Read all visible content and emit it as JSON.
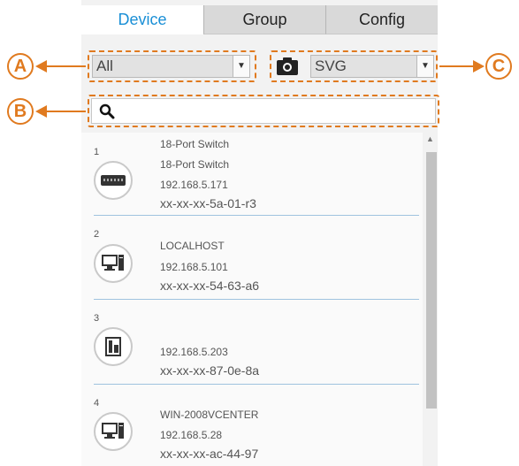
{
  "tabs": [
    {
      "label": "Device"
    },
    {
      "label": "Group"
    },
    {
      "label": "Config"
    }
  ],
  "filter": {
    "selected": "All"
  },
  "format": {
    "selected": "SVG"
  },
  "search": {
    "value": ""
  },
  "callouts": {
    "a": "A",
    "b": "B",
    "c": "C"
  },
  "devices": [
    {
      "index": "1",
      "name1": "18-Port Switch",
      "name2": "18-Port Switch",
      "ip": "192.168.5.171",
      "mac": "xx-xx-xx-5a-01-r3",
      "icon": "switch-icon"
    },
    {
      "index": "2",
      "name1": "LOCALHOST",
      "ip": "192.168.5.101",
      "mac": "xx-xx-xx-54-63-a6",
      "icon": "computer-icon"
    },
    {
      "index": "3",
      "name1": "",
      "ip": "192.168.5.203",
      "mac": "xx-xx-xx-87-0e-8a",
      "icon": "server-icon"
    },
    {
      "index": "4",
      "name1": "WIN-2008VCENTER",
      "ip": "192.168.5.28",
      "mac": "xx-xx-xx-ac-44-97",
      "icon": "computer-icon"
    }
  ],
  "colors": {
    "accent": "#1a8fd6",
    "callout": "#e07a1f"
  }
}
